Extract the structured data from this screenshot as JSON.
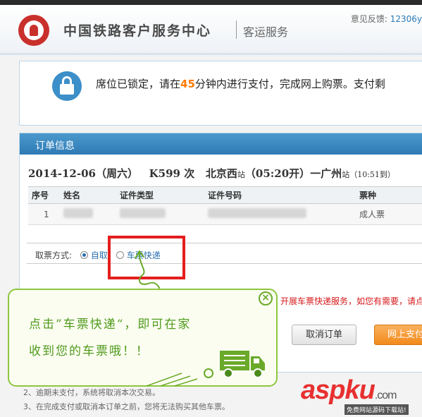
{
  "header": {
    "title": "中国铁路客户服务中心",
    "subtitle": "客运服务",
    "feedback_label": "意见反馈:",
    "feedback_value": "12306y"
  },
  "notice": {
    "text_before": "席位已锁定，请在",
    "minutes": "45",
    "text_after": "分钟内进行支付，完成网上购票。支付剩"
  },
  "order": {
    "section_title": "订单信息",
    "trip": {
      "date": "2014-12-06（周六）",
      "train": "K599 次",
      "from": "北京西",
      "from_suffix": "站",
      "depart": "（05:20开）",
      "to": "一广州",
      "to_suffix": "站",
      "arrive": "（10:51到）"
    },
    "columns": [
      "序号",
      "姓名",
      "证件类型",
      "证件号码",
      "票种"
    ],
    "rows": [
      {
        "index": "1",
        "ticket_type": "成人票"
      }
    ],
    "method_label": "取票方式:",
    "method_options": [
      "自取",
      "车票快递"
    ],
    "promo_text": "开展车票快递服务，如您有需要，请点",
    "cancel_label": "取消订单",
    "pay_label": "网上支付"
  },
  "tips": [
    "2、逾期未支付，系统将取消本次交易。",
    "3、在完成支付或取消本订单之前，您将无法购买其他车票。"
  ],
  "callout": {
    "line1": "点击”车票快递“，即可在家",
    "line2": "收到您的车票哦！！"
  },
  "watermark": {
    "brand": "aspku",
    "domain": ".com",
    "tagline": "免费网站源码下载站!"
  }
}
